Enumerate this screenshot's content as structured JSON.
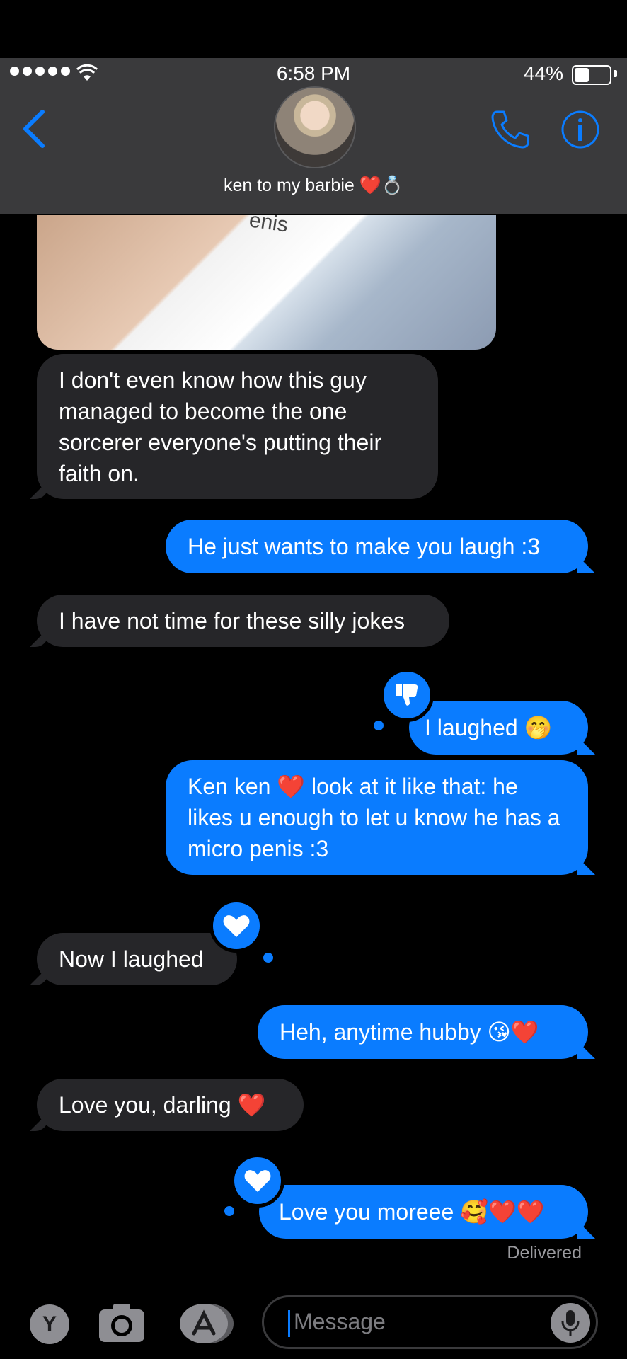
{
  "status_bar": {
    "time": "6:58 PM",
    "battery": "44%"
  },
  "header": {
    "contact_name": "ken to my barbie ❤️💍"
  },
  "photo": {
    "caption_fragment": "enis"
  },
  "messages": [
    {
      "dir": "in",
      "text": "I don't even know how this guy managed to become the one sorcerer everyone's putting their faith on."
    },
    {
      "dir": "out",
      "text": "He just wants to make you laugh :3"
    },
    {
      "dir": "in",
      "text": "I have not time for these silly jokes"
    },
    {
      "dir": "out",
      "text": "I laughed 🤭",
      "reaction": "thumbs-down-icon"
    },
    {
      "dir": "out",
      "text": "Ken ken ❤️ look at it like that: he likes u enough to let u know he has a micro penis :3"
    },
    {
      "dir": "in",
      "text": "Now I laughed",
      "reaction": "heart-icon"
    },
    {
      "dir": "out",
      "text": "Heh, anytime hubby 😘❤️"
    },
    {
      "dir": "in",
      "text": "Love you, darling ❤️"
    },
    {
      "dir": "out",
      "text": "Love you moreee 🥰❤️❤️",
      "reaction": "heart-icon"
    }
  ],
  "delivered_label": "Delivered",
  "composer": {
    "y_button": "Y",
    "placeholder": "Message"
  }
}
